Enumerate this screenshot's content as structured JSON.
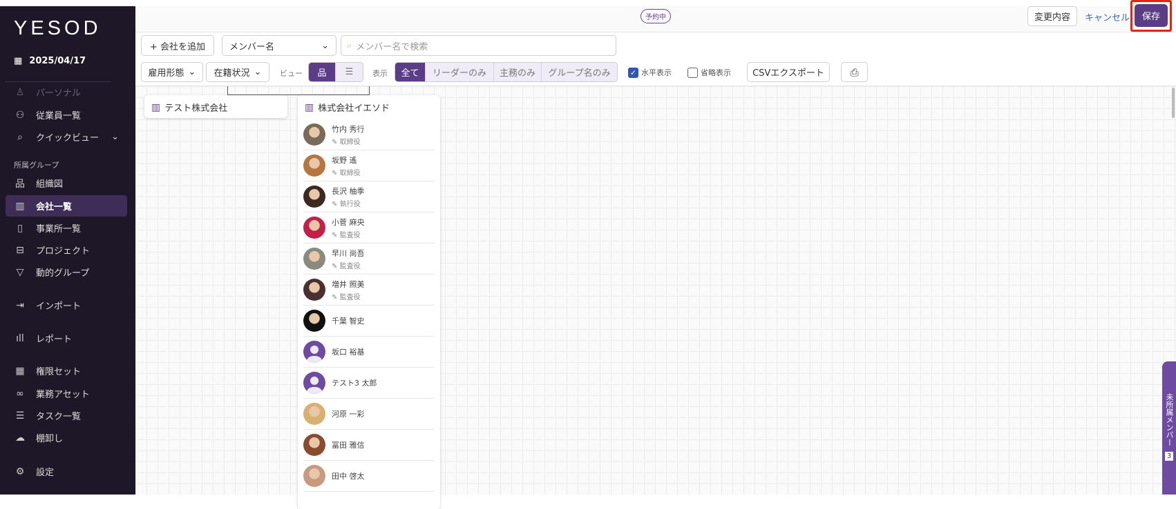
{
  "sidebar": {
    "logo": "YESOD",
    "date": "2025/04/17",
    "section": "所属グループ",
    "items": [
      {
        "label": "パーソナル",
        "icon": "person-icon"
      },
      {
        "label": "従業員一覧",
        "icon": "users-icon"
      },
      {
        "label": "クイックビュー",
        "icon": "search-icon"
      },
      {
        "label": "組織図",
        "icon": "org-chart-icon"
      },
      {
        "label": "会社一覧",
        "icon": "building-icon"
      },
      {
        "label": "事業所一覧",
        "icon": "office-icon"
      },
      {
        "label": "プロジェクト",
        "icon": "briefcase-icon"
      },
      {
        "label": "動的グループ",
        "icon": "filter-icon"
      },
      {
        "label": "インポート",
        "icon": "import-icon"
      },
      {
        "label": "レポート",
        "icon": "bar-chart-icon"
      },
      {
        "label": "権限セット",
        "icon": "grid-icon"
      },
      {
        "label": "業務アセット",
        "icon": "link-icon"
      },
      {
        "label": "タスク一覧",
        "icon": "checklist-icon"
      },
      {
        "label": "棚卸し",
        "icon": "cloud-download-icon"
      },
      {
        "label": "設定",
        "icon": "gear-icon"
      }
    ]
  },
  "header": {
    "badge": "予約中",
    "changes": "変更内容",
    "cancel": "キャンセル",
    "save": "保存"
  },
  "toolbar": {
    "add_company": "+ 会社を追加",
    "field_select": "メンバー名",
    "search_placeholder": "メンバー名で検索",
    "employment": "雇用形態",
    "status": "在籍状況",
    "view_label": "ビュー",
    "display_label": "表示",
    "display_options": [
      "全て",
      "リーダーのみ",
      "主務のみ",
      "グループ名のみ"
    ],
    "horizontal": "水平表示",
    "horizontal_checked": true,
    "compact": "省略表示",
    "compact_checked": false,
    "csv": "CSVエクスポート"
  },
  "companies": [
    {
      "name": "テスト株式会社",
      "members": []
    },
    {
      "name": "株式会社イエソド",
      "members": [
        {
          "name": "竹内 秀行",
          "role": "取締役",
          "avatar": "#7a6a5a"
        },
        {
          "name": "坂野 遙",
          "role": "取締役",
          "avatar": "#b5763f"
        },
        {
          "name": "長沢 柚季",
          "role": "執行役",
          "avatar": "#3b2a22"
        },
        {
          "name": "小菅 麻央",
          "role": "監査役",
          "avatar": "#c2204a"
        },
        {
          "name": "早川 尚吾",
          "role": "監査役",
          "avatar": "#8a8a80"
        },
        {
          "name": "増井 照美",
          "role": "監査役",
          "avatar": "#4a3032"
        },
        {
          "name": "千葉 智史",
          "role": "",
          "avatar": "#111111"
        },
        {
          "name": "坂口 裕基",
          "role": "",
          "avatar": "default"
        },
        {
          "name": "テスト3 太郎",
          "role": "",
          "avatar": "default"
        },
        {
          "name": "河原 一彩",
          "role": "",
          "avatar": "#d9b070"
        },
        {
          "name": "冨田 雅信",
          "role": "",
          "avatar": "#8a4a2e"
        },
        {
          "name": "田中 啓太",
          "role": "",
          "avatar": "#c89a80"
        }
      ]
    }
  ],
  "unassigned": {
    "label": "未所属メンバー",
    "count": "3"
  }
}
